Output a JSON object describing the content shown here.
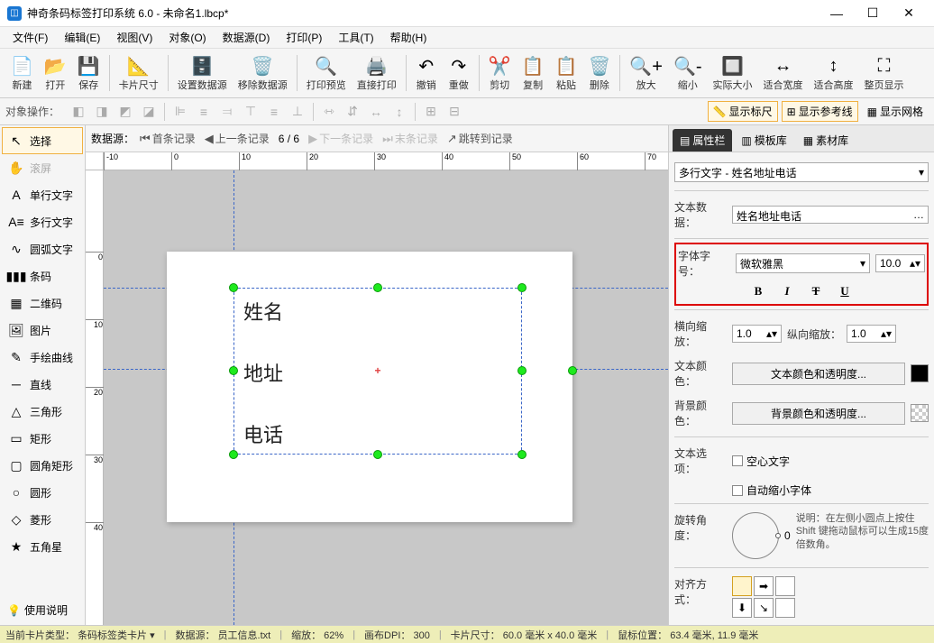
{
  "app": {
    "title": "神奇条码标签打印系统 6.0 - 未命名1.lbcp*"
  },
  "menu": [
    "文件(F)",
    "编辑(E)",
    "视图(V)",
    "对象(O)",
    "数据源(D)",
    "打印(P)",
    "工具(T)",
    "帮助(H)"
  ],
  "toolbar": [
    {
      "label": "新建",
      "icon": "📄"
    },
    {
      "label": "打开",
      "icon": "📂"
    },
    {
      "label": "保存",
      "icon": "💾"
    },
    {
      "sep": true
    },
    {
      "label": "卡片尺寸",
      "icon": "📐"
    },
    {
      "sep": true
    },
    {
      "label": "设置数据源",
      "icon": "🗄️"
    },
    {
      "label": "移除数据源",
      "icon": "🗑️"
    },
    {
      "sep": true
    },
    {
      "label": "打印预览",
      "icon": "🔍"
    },
    {
      "label": "直接打印",
      "icon": "🖨️"
    },
    {
      "sep": true
    },
    {
      "label": "撤销",
      "icon": "↶"
    },
    {
      "label": "重做",
      "icon": "↷"
    },
    {
      "sep": true
    },
    {
      "label": "剪切",
      "icon": "✂️"
    },
    {
      "label": "复制",
      "icon": "📋"
    },
    {
      "label": "粘贴",
      "icon": "📋"
    },
    {
      "label": "删除",
      "icon": "🗑️"
    },
    {
      "sep": true
    },
    {
      "label": "放大",
      "icon": "🔍+"
    },
    {
      "label": "缩小",
      "icon": "🔍-"
    },
    {
      "label": "实际大小",
      "icon": "🔲"
    },
    {
      "label": "适合宽度",
      "icon": "↔"
    },
    {
      "label": "适合高度",
      "icon": "↕"
    },
    {
      "label": "整页显示",
      "icon": "⛶"
    }
  ],
  "opsbar": {
    "label": "对象操作：",
    "toggles": [
      {
        "label": "显示标尺",
        "icon": "📏",
        "on": true
      },
      {
        "label": "显示参考线",
        "icon": "⊞",
        "on": true
      },
      {
        "label": "显示网格",
        "icon": "▦",
        "on": false
      }
    ]
  },
  "palette": [
    {
      "icon": "↖",
      "label": "选择",
      "sel": true
    },
    {
      "icon": "✋",
      "label": "滚屏",
      "disabled": true
    },
    {
      "icon": "A",
      "label": "单行文字"
    },
    {
      "icon": "A≡",
      "label": "多行文字"
    },
    {
      "icon": "∿",
      "label": "圆弧文字"
    },
    {
      "icon": "▮▮▮",
      "label": "条码"
    },
    {
      "icon": "▦",
      "label": "二维码"
    },
    {
      "icon": "🖼",
      "label": "图片"
    },
    {
      "icon": "✎",
      "label": "手绘曲线"
    },
    {
      "icon": "─",
      "label": "直线"
    },
    {
      "icon": "△",
      "label": "三角形"
    },
    {
      "icon": "▭",
      "label": "矩形"
    },
    {
      "icon": "▢",
      "label": "圆角矩形"
    },
    {
      "icon": "○",
      "label": "圆形"
    },
    {
      "icon": "◇",
      "label": "菱形"
    },
    {
      "icon": "★",
      "label": "五角星"
    }
  ],
  "help_label": "使用说明",
  "databar": {
    "label": "数据源：",
    "first": "首条记录",
    "prev": "上一条记录",
    "pos": "6 / 6",
    "next": "下一条记录",
    "last": "末条记录",
    "jump": "跳转到记录"
  },
  "canvas_text": {
    "name": "姓名",
    "addr": "地址",
    "phone": "电话"
  },
  "ruler_h": [
    "-10",
    "0",
    "10",
    "20",
    "30",
    "40",
    "50",
    "60",
    "70"
  ],
  "ruler_v": [
    "0",
    "10",
    "20",
    "30",
    "40"
  ],
  "rightpanel": {
    "tabs": [
      "属性栏",
      "模板库",
      "素材库"
    ],
    "object_selector": "多行文字 - 姓名地址电话",
    "text_data_label": "文本数据：",
    "text_data_value": "姓名地址电话",
    "font_label": "字体字号：",
    "font_family": "微软雅黑",
    "font_size": "10.0",
    "hscale_label": "横向缩放：",
    "hscale": "1.0",
    "vscale_label": "纵向缩放：",
    "vscale": "1.0",
    "textcolor_label": "文本颜色：",
    "textcolor_btn": "文本颜色和透明度...",
    "bgcolor_label": "背景颜色：",
    "bgcolor_btn": "背景颜色和透明度...",
    "textopt_label": "文本选项：",
    "hollow": "空心文字",
    "autoshrink": "自动缩小字体",
    "rotate_label": "旋转角度：",
    "rotate_value": "0",
    "rotate_hint": "说明：在左侧小圆点上按住 Shift 键拖动鼠标可以生成15度倍数角。",
    "align_label": "对齐方式："
  },
  "status": {
    "cardtype_l": "当前卡片类型：",
    "cardtype_v": "条码标签类卡片",
    "ds_l": "数据源：",
    "ds_v": "员工信息.txt",
    "zoom_l": "缩放：",
    "zoom_v": "62%",
    "dpi_l": "画布DPI：",
    "dpi_v": "300",
    "size_l": "卡片尺寸：",
    "size_v": "60.0 毫米 x 40.0 毫米",
    "mouse_l": "鼠标位置：",
    "mouse_v": "63.4 毫米, 11.9 毫米"
  }
}
